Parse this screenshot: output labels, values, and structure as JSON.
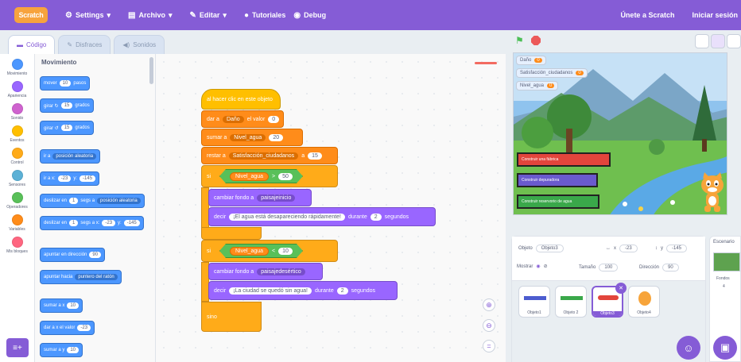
{
  "menubar": {
    "logo": "Scratch",
    "settings": "Settings",
    "file": "Archivo",
    "edit": "Editar",
    "tutorials": "Tutoriales",
    "debug": "Debug",
    "join": "Únete a Scratch",
    "signin": "Iniciar sesión"
  },
  "tabs": {
    "code": "Código",
    "costumes": "Disfraces",
    "sounds": "Sonidos"
  },
  "categories": [
    {
      "label": "Movimiento",
      "color": "#4c97ff"
    },
    {
      "label": "Apariencia",
      "color": "#9966ff"
    },
    {
      "label": "Sonido",
      "color": "#cf63cf"
    },
    {
      "label": "Eventos",
      "color": "#ffbf00"
    },
    {
      "label": "Control",
      "color": "#ffab19"
    },
    {
      "label": "Sensores",
      "color": "#5cb1d6"
    },
    {
      "label": "Operadores",
      "color": "#59c059"
    },
    {
      "label": "Variables",
      "color": "#ff8c1a"
    },
    {
      "label": "Mis bloques",
      "color": "#ff6680"
    }
  ],
  "palette": {
    "title": "Movimiento",
    "b1": {
      "a": "mover",
      "v": "10",
      "b": "pasos"
    },
    "b2": {
      "a": "girar ↻",
      "v": "15",
      "b": "grados"
    },
    "b3": {
      "a": "girar ↺",
      "v": "15",
      "b": "grados"
    },
    "b4": {
      "a": "ir a",
      "d": "posición aleatoria"
    },
    "b5": {
      "a": "ir a x:",
      "x": "-23",
      "b": "y:",
      "y": "-145"
    },
    "b6": {
      "a": "deslizar en",
      "v": "1",
      "b": "segs a",
      "d": "posición aleatoria"
    },
    "b7": {
      "a": "deslizar en",
      "v": "1",
      "b": "segs a x:",
      "x": "-23",
      "c": "y:",
      "y": "-145"
    },
    "b8": {
      "a": "apuntar en dirección",
      "v": "90"
    },
    "b9": {
      "a": "apuntar hacia",
      "d": "puntero del ratón"
    },
    "b10": {
      "a": "sumar a x",
      "v": "10"
    },
    "b11": {
      "a": "dar a x el valor",
      "v": "-23"
    },
    "b12": {
      "a": "sumar a y",
      "v": "10"
    }
  },
  "script": {
    "hat": "al hacer clic en este objeto",
    "s1": {
      "a": "dar a",
      "var": "Daño",
      "b": "el valor",
      "v": "0"
    },
    "s2": {
      "a": "sumar a",
      "var": "Nivel_agua",
      "b": "",
      "v": "20"
    },
    "s3": {
      "a": "restar a",
      "var": "Satisfacción_ciudadanos",
      "b": "a",
      "v": "15"
    },
    "if1": {
      "a": "si",
      "var": "Nivel_agua",
      "op": ">",
      "v": "50",
      "b": "entonces"
    },
    "l1": {
      "a": "cambiar fondo a",
      "d": "paisajeinicio"
    },
    "l2": {
      "a": "decir",
      "msg": "¡El agua está desapareciendo rápidamente!",
      "b": "durante",
      "v": "2",
      "c": "segundos"
    },
    "if2": {
      "a": "si",
      "var": "Nivel_agua",
      "op": "<",
      "v": "10",
      "b": "entonces"
    },
    "l3": {
      "a": "cambiar fondo a",
      "d": "paisajedesértico"
    },
    "l4": {
      "a": "decir",
      "msg": "¡La ciudad se quedó sin agua!",
      "b": "durante",
      "v": "2",
      "c": "segundos"
    },
    "end": "sino"
  },
  "stage": {
    "monitors": [
      {
        "label": "Daño",
        "value": "0"
      },
      {
        "label": "Satisfacción_ciudadanos",
        "value": "0"
      },
      {
        "label": "Nivel_agua",
        "value": "0"
      }
    ],
    "buttons": [
      "Construir una fábrica",
      "Construir depuradora",
      "Construir reservorio de agua"
    ]
  },
  "sprite_info": {
    "sprite_label": "Objeto",
    "sprite_name": "Objeto3",
    "x_label": "x",
    "x_value": "-23",
    "y_label": "y",
    "y_value": "-145",
    "show_label": "Mostrar",
    "size_label": "Tamaño",
    "size_value": "100",
    "dir_label": "Dirección",
    "dir_value": "90"
  },
  "sprites": [
    "Objeto1",
    "Objeto 2",
    "Objeto3",
    "Objeto4"
  ],
  "stage_panel": {
    "title": "Escenario",
    "backdrops": "Fondos",
    "count": "4"
  }
}
